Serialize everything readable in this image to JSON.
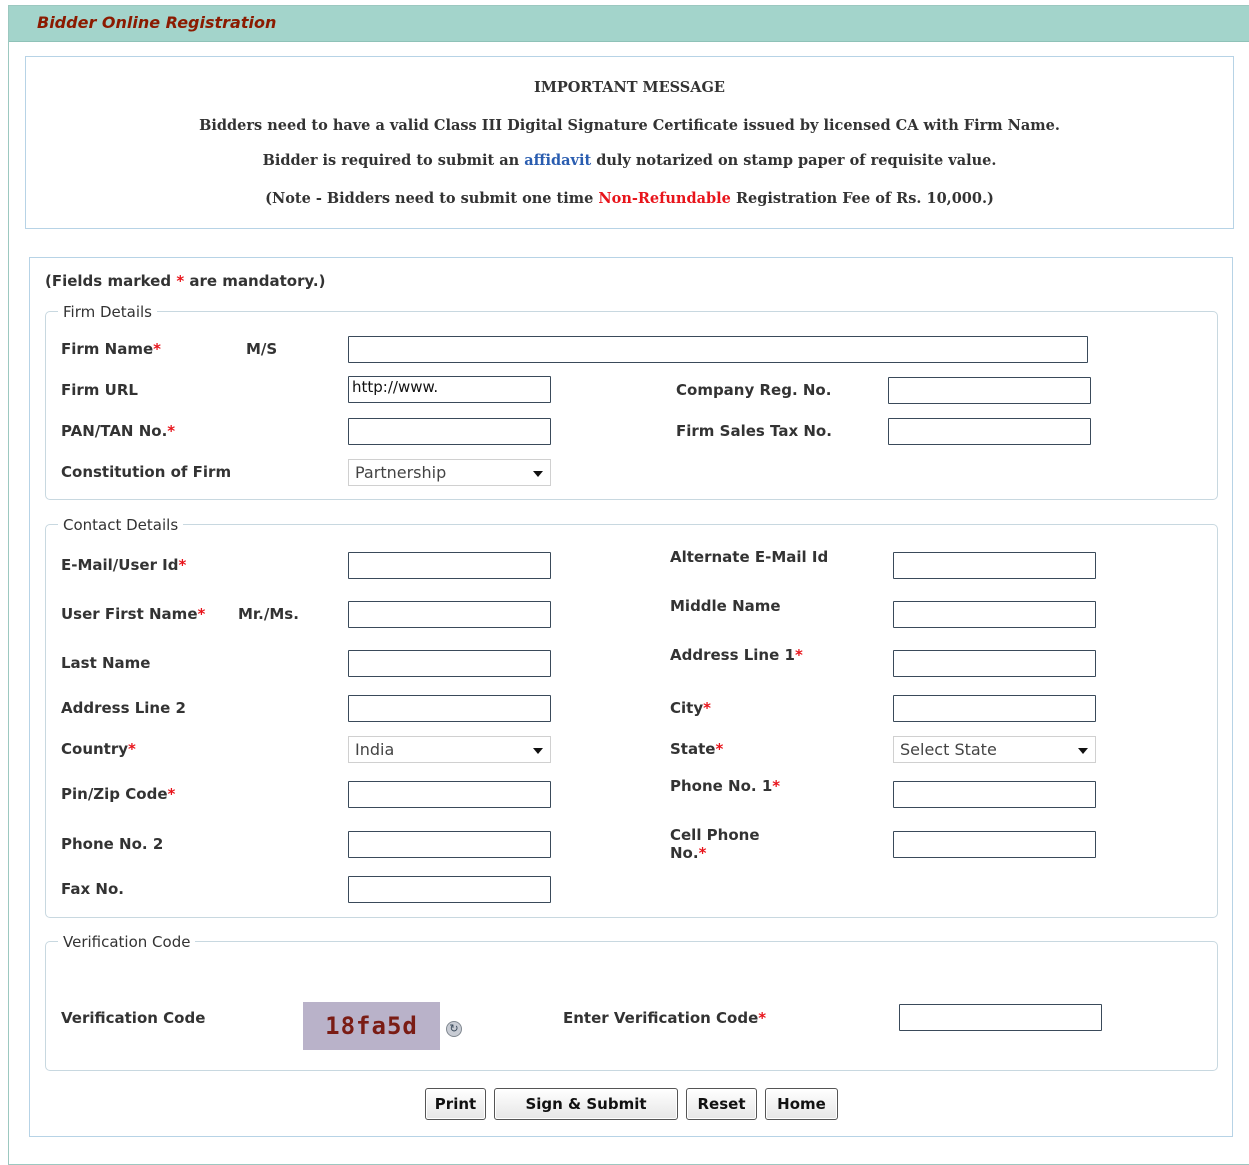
{
  "title": "Bidder Online Registration",
  "message": {
    "heading": "IMPORTANT MESSAGE",
    "line1": "Bidders need to have a valid Class III Digital Signature Certificate issued by licensed CA with Firm Name.",
    "line2_pre": "Bidder is required to submit an ",
    "line2_link": "affidavit",
    "line2_post": " duly notarized on stamp paper of requisite value.",
    "line3_pre": "(Note - Bidders need to submit one time ",
    "line3_red": "Non-Refundable",
    "line3_post": " Registration Fee of Rs. 10,000.)"
  },
  "mandatory_note": {
    "pre": "(Fields marked ",
    "star": "*",
    "post": " are mandatory.)"
  },
  "firm": {
    "legend": "Firm Details",
    "firm_name_label": "Firm Name",
    "ms_label": "M/S",
    "firm_name_value": "",
    "firm_url_label": "Firm URL",
    "firm_url_value": "http://www.",
    "company_reg_label": "Company Reg. No.",
    "company_reg_value": "",
    "pan_label": "PAN/TAN No.",
    "pan_value": "",
    "sales_tax_label": "Firm Sales Tax No.",
    "sales_tax_value": "",
    "constitution_label": "Constitution of Firm",
    "constitution_value": "Partnership"
  },
  "contact": {
    "legend": "Contact Details",
    "email_label": "E-Mail/User Id",
    "alt_email_label": "Alternate E-Mail Id",
    "first_name_label": "User First Name",
    "mr_ms_label": "Mr./Ms.",
    "middle_name_label": "Middle Name",
    "last_name_label": "Last Name",
    "address1_label": "Address Line 1",
    "address2_label": "Address Line 2",
    "city_label": "City",
    "country_label": "Country",
    "country_value": "India",
    "state_label": "State",
    "state_value": "Select State",
    "pin_label": "Pin/Zip Code",
    "phone1_label": "Phone No. 1",
    "phone2_label": "Phone No. 2",
    "cell_label_1": "Cell Phone",
    "cell_label_2": "No.",
    "fax_label": "Fax No."
  },
  "verification": {
    "legend": "Verification Code",
    "code_label": "Verification Code",
    "captcha_text": "18fa5d",
    "enter_label": "Enter Verification Code",
    "enter_value": ""
  },
  "buttons": {
    "print": "Print",
    "sign_submit": "Sign & Submit",
    "reset": "Reset",
    "home": "Home"
  },
  "required_star": "*",
  "colors": {
    "title_bar": "#a3d4cb",
    "title_text": "#8b1a00",
    "required": "#e8141b",
    "link": "#2a5db0"
  }
}
